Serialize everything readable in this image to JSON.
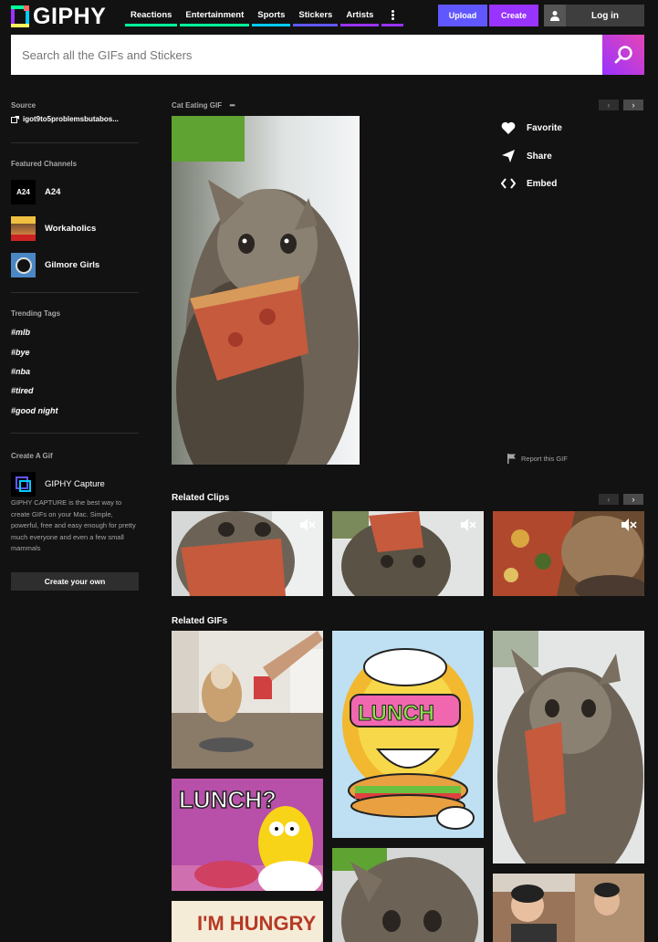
{
  "header": {
    "logo_text": "GIPHY",
    "nav": [
      {
        "label": "Reactions",
        "color": "#00ff99"
      },
      {
        "label": "Entertainment",
        "color": "#00ff99"
      },
      {
        "label": "Sports",
        "color": "#00ccff"
      },
      {
        "label": "Stickers",
        "color": "#6157ff"
      },
      {
        "label": "Artists",
        "color": "#9933ff"
      }
    ],
    "upload_label": "Upload",
    "create_label": "Create",
    "login_label": "Log in"
  },
  "search": {
    "placeholder": "Search all the GIFs and Stickers"
  },
  "sidebar": {
    "source_title": "Source",
    "source_value": "igot9to5problemsbutabos...",
    "featured_title": "Featured Channels",
    "channels": [
      {
        "name": "A24",
        "avatar_text": "A24"
      },
      {
        "name": "Workaholics"
      },
      {
        "name": "Gilmore Girls"
      }
    ],
    "trending_title": "Trending Tags",
    "tags": [
      "#mlb",
      "#bye",
      "#nba",
      "#tired",
      "#good night"
    ],
    "create_title": "Create A Gif",
    "capture_name": "GIPHY Capture",
    "capture_desc": "GIPHY CAPTURE is the best way to create GIFs on your Mac. Simple, powerful, free and easy enough for pretty much everyone and even a few small mammals",
    "create_button": "Create your own"
  },
  "main": {
    "gif_title": "Cat Eating GIF",
    "more_dots": "•••",
    "actions": [
      {
        "label": "Favorite",
        "icon": "heart-icon"
      },
      {
        "label": "Share",
        "icon": "share-icon"
      },
      {
        "label": "Embed",
        "icon": "embed-icon"
      }
    ],
    "report_label": "Report this GIF",
    "related_clips_title": "Related Clips",
    "related_gifs_title": "Related GIFs",
    "gif_texts": {
      "lunch_sign": "LUNCH",
      "lunch_q": "LUNCH?",
      "hungry": "I'M HUNGRY"
    }
  },
  "colors": {
    "accent_purple": "#9933ff",
    "upload_blue": "#6157ff",
    "bg": "#121212"
  }
}
